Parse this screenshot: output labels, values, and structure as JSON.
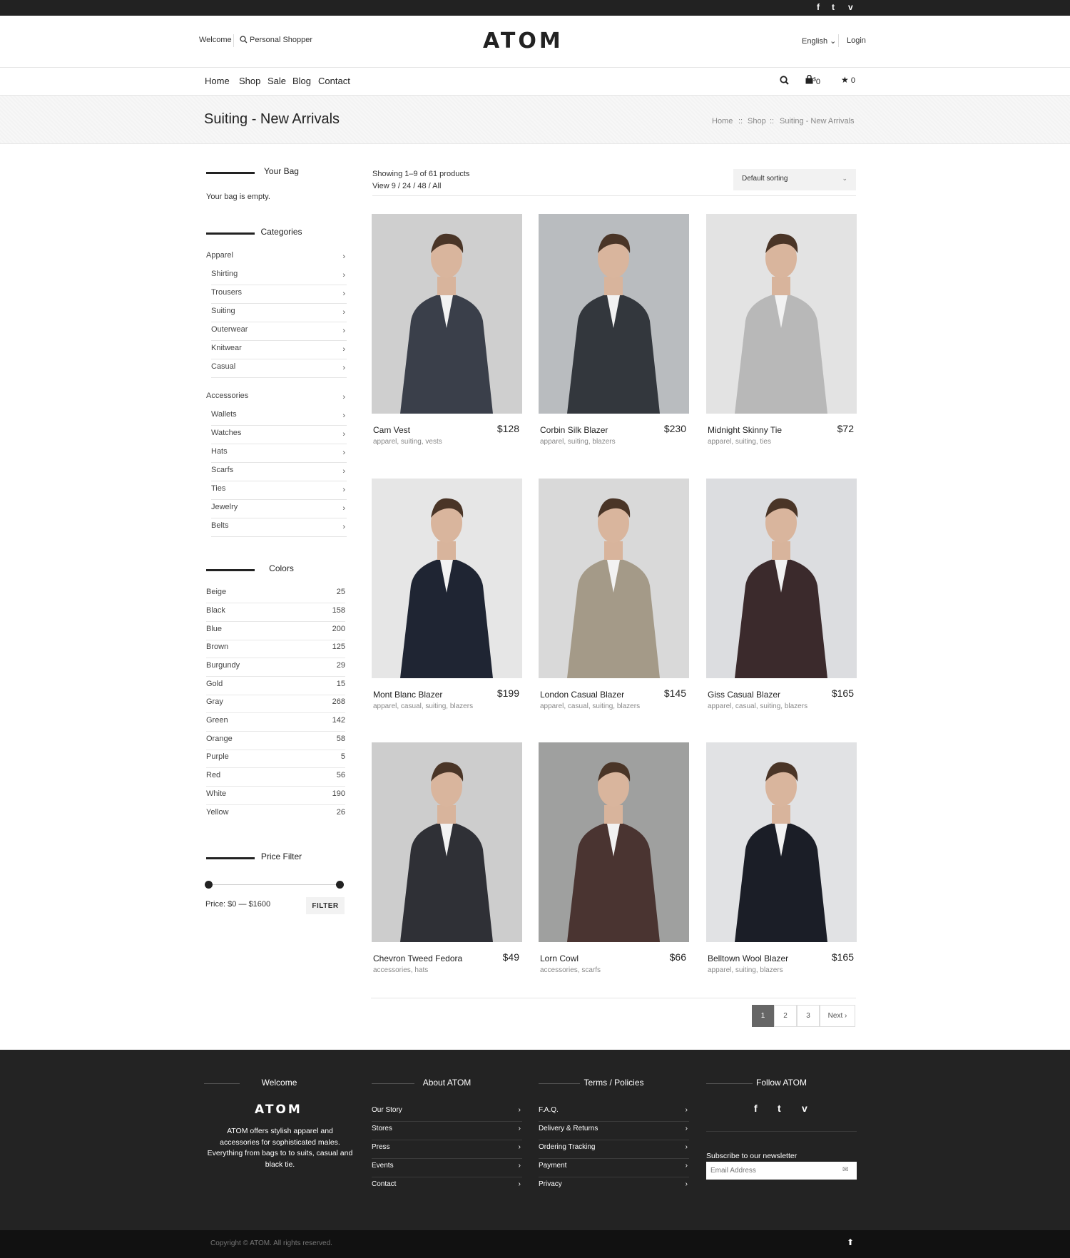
{
  "topbar": {
    "social": [
      "f",
      "t",
      "v"
    ]
  },
  "header": {
    "welcome": "Welcome",
    "personal_shopper": "Personal Shopper",
    "logo": "ATOM",
    "language": "English",
    "language_caret": "⌄",
    "login": "Login"
  },
  "nav": {
    "items": [
      "Home",
      "Shop",
      "Sale",
      "Blog",
      "Contact"
    ],
    "cart_count": "0",
    "cart_currency": "$",
    "wishlist_count": "0"
  },
  "page": {
    "title": "Suiting - New Arrivals",
    "breadcrumb": [
      "Home",
      "Shop",
      "Suiting - New Arrivals"
    ],
    "breadcrumb_sep": "::"
  },
  "sidebar": {
    "bag_title": "Your Bag",
    "bag_empty": "Your bag is empty.",
    "categories_title": "Categories",
    "apparel": "Apparel",
    "apparel_items": [
      "Shirting",
      "Trousers",
      "Suiting",
      "Outerwear",
      "Knitwear",
      "Casual"
    ],
    "accessories": "Accessories",
    "accessories_items": [
      "Wallets",
      "Watches",
      "Hats",
      "Scarfs",
      "Ties",
      "Jewelry",
      "Belts"
    ],
    "colors_title": "Colors",
    "colors": [
      {
        "name": "Beige",
        "count": "25"
      },
      {
        "name": "Black",
        "count": "158"
      },
      {
        "name": "Blue",
        "count": "200"
      },
      {
        "name": "Brown",
        "count": "125"
      },
      {
        "name": "Burgundy",
        "count": "29"
      },
      {
        "name": "Gold",
        "count": "15"
      },
      {
        "name": "Gray",
        "count": "268"
      },
      {
        "name": "Green",
        "count": "142"
      },
      {
        "name": "Orange",
        "count": "58"
      },
      {
        "name": "Purple",
        "count": "5"
      },
      {
        "name": "Red",
        "count": "56"
      },
      {
        "name": "White",
        "count": "190"
      },
      {
        "name": "Yellow",
        "count": "26"
      }
    ],
    "price_title": "Price Filter",
    "price_text": "Price: $0 — $1600",
    "filter_label": "FILTER",
    "price_min": 0,
    "price_max": 1600
  },
  "main": {
    "showing": "Showing 1–9 of 61 products",
    "view": "View 9 / 24 / 48 / All",
    "sorting": "Default sorting",
    "products": [
      {
        "name": "Cam Vest",
        "price": "$128",
        "tags": "apparel, suiting, vests",
        "bg": "#cfcfcf",
        "suit": "#3a3f4a"
      },
      {
        "name": "Corbin Silk Blazer",
        "price": "$230",
        "tags": "apparel, suiting, blazers",
        "bg": "#b9bcbf",
        "suit": "#33373d"
      },
      {
        "name": "Midnight Skinny Tie",
        "price": "$72",
        "tags": "apparel, suiting, ties",
        "bg": "#e3e3e3",
        "suit": "#b8b8b8"
      },
      {
        "name": "Mont Blanc Blazer",
        "price": "$199",
        "tags": "apparel, casual, suiting, blazers",
        "bg": "#e6e6e6",
        "suit": "#1f2533"
      },
      {
        "name": "London Casual Blazer",
        "price": "$145",
        "tags": "apparel, casual, suiting, blazers",
        "bg": "#d9d9d9",
        "suit": "#a49a88"
      },
      {
        "name": "Giss Casual Blazer",
        "price": "$165",
        "tags": "apparel, casual, suiting, blazers",
        "bg": "#dcdde0",
        "suit": "#3b2a2c"
      },
      {
        "name": "Chevron Tweed Fedora",
        "price": "$49",
        "tags": "accessories, hats",
        "bg": "#cdcdcd",
        "suit": "#2f3036"
      },
      {
        "name": "Lorn Cowl",
        "price": "$66",
        "tags": "accessories, scarfs",
        "bg": "#9fa09f",
        "suit": "#4a3431"
      },
      {
        "name": "Belltown Wool Blazer",
        "price": "$165",
        "tags": "apparel, suiting, blazers",
        "bg": "#e1e2e4",
        "suit": "#1b1e27"
      }
    ],
    "pagination": [
      "1",
      "2",
      "3",
      "Next ›"
    ]
  },
  "footer": {
    "welcome_title": "Welcome",
    "logo": "ATOM",
    "description": "ATOM offers stylish apparel and accessories for sophisticated males. Everything from bags to to suits, casual and black tie.",
    "about_title": "About ATOM",
    "about_links": [
      "Our Story",
      "Stores",
      "Press",
      "Events",
      "Contact"
    ],
    "terms_title": "Terms / Policies",
    "terms_links": [
      "F.A.Q.",
      "Delivery & Returns",
      "Ordering Tracking",
      "Payment",
      "Privacy"
    ],
    "follow_title": "Follow ATOM",
    "social": [
      "f",
      "t",
      "v"
    ],
    "subscribe": "Subscribe to our newsletter",
    "email_placeholder": "Email Address"
  },
  "copyright": "Copyright  ©  ATOM. All rights reserved.",
  "colors": {
    "dark": "#222222",
    "footer": "#232323",
    "copyright_bar": "#111111",
    "page_active": "#666666"
  }
}
